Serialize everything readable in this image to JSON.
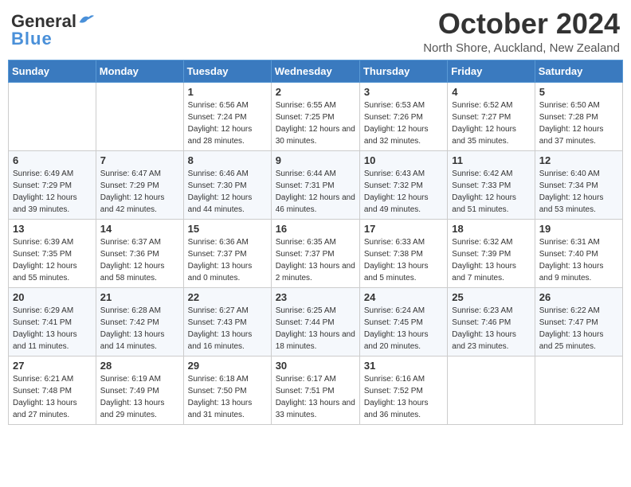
{
  "header": {
    "logo": {
      "general": "General",
      "blue": "Blue"
    },
    "title": "October 2024",
    "subtitle": "North Shore, Auckland, New Zealand"
  },
  "days_of_week": [
    "Sunday",
    "Monday",
    "Tuesday",
    "Wednesday",
    "Thursday",
    "Friday",
    "Saturday"
  ],
  "weeks": [
    [
      {
        "day": "",
        "info": ""
      },
      {
        "day": "",
        "info": ""
      },
      {
        "day": "1",
        "sunrise": "6:56 AM",
        "sunset": "7:24 PM",
        "daylight": "12 hours and 28 minutes."
      },
      {
        "day": "2",
        "sunrise": "6:55 AM",
        "sunset": "7:25 PM",
        "daylight": "12 hours and 30 minutes."
      },
      {
        "day": "3",
        "sunrise": "6:53 AM",
        "sunset": "7:26 PM",
        "daylight": "12 hours and 32 minutes."
      },
      {
        "day": "4",
        "sunrise": "6:52 AM",
        "sunset": "7:27 PM",
        "daylight": "12 hours and 35 minutes."
      },
      {
        "day": "5",
        "sunrise": "6:50 AM",
        "sunset": "7:28 PM",
        "daylight": "12 hours and 37 minutes."
      }
    ],
    [
      {
        "day": "6",
        "sunrise": "6:49 AM",
        "sunset": "7:29 PM",
        "daylight": "12 hours and 39 minutes."
      },
      {
        "day": "7",
        "sunrise": "6:47 AM",
        "sunset": "7:29 PM",
        "daylight": "12 hours and 42 minutes."
      },
      {
        "day": "8",
        "sunrise": "6:46 AM",
        "sunset": "7:30 PM",
        "daylight": "12 hours and 44 minutes."
      },
      {
        "day": "9",
        "sunrise": "6:44 AM",
        "sunset": "7:31 PM",
        "daylight": "12 hours and 46 minutes."
      },
      {
        "day": "10",
        "sunrise": "6:43 AM",
        "sunset": "7:32 PM",
        "daylight": "12 hours and 49 minutes."
      },
      {
        "day": "11",
        "sunrise": "6:42 AM",
        "sunset": "7:33 PM",
        "daylight": "12 hours and 51 minutes."
      },
      {
        "day": "12",
        "sunrise": "6:40 AM",
        "sunset": "7:34 PM",
        "daylight": "12 hours and 53 minutes."
      }
    ],
    [
      {
        "day": "13",
        "sunrise": "6:39 AM",
        "sunset": "7:35 PM",
        "daylight": "12 hours and 55 minutes."
      },
      {
        "day": "14",
        "sunrise": "6:37 AM",
        "sunset": "7:36 PM",
        "daylight": "12 hours and 58 minutes."
      },
      {
        "day": "15",
        "sunrise": "6:36 AM",
        "sunset": "7:37 PM",
        "daylight": "13 hours and 0 minutes."
      },
      {
        "day": "16",
        "sunrise": "6:35 AM",
        "sunset": "7:37 PM",
        "daylight": "13 hours and 2 minutes."
      },
      {
        "day": "17",
        "sunrise": "6:33 AM",
        "sunset": "7:38 PM",
        "daylight": "13 hours and 5 minutes."
      },
      {
        "day": "18",
        "sunrise": "6:32 AM",
        "sunset": "7:39 PM",
        "daylight": "13 hours and 7 minutes."
      },
      {
        "day": "19",
        "sunrise": "6:31 AM",
        "sunset": "7:40 PM",
        "daylight": "13 hours and 9 minutes."
      }
    ],
    [
      {
        "day": "20",
        "sunrise": "6:29 AM",
        "sunset": "7:41 PM",
        "daylight": "13 hours and 11 minutes."
      },
      {
        "day": "21",
        "sunrise": "6:28 AM",
        "sunset": "7:42 PM",
        "daylight": "13 hours and 14 minutes."
      },
      {
        "day": "22",
        "sunrise": "6:27 AM",
        "sunset": "7:43 PM",
        "daylight": "13 hours and 16 minutes."
      },
      {
        "day": "23",
        "sunrise": "6:25 AM",
        "sunset": "7:44 PM",
        "daylight": "13 hours and 18 minutes."
      },
      {
        "day": "24",
        "sunrise": "6:24 AM",
        "sunset": "7:45 PM",
        "daylight": "13 hours and 20 minutes."
      },
      {
        "day": "25",
        "sunrise": "6:23 AM",
        "sunset": "7:46 PM",
        "daylight": "13 hours and 23 minutes."
      },
      {
        "day": "26",
        "sunrise": "6:22 AM",
        "sunset": "7:47 PM",
        "daylight": "13 hours and 25 minutes."
      }
    ],
    [
      {
        "day": "27",
        "sunrise": "6:21 AM",
        "sunset": "7:48 PM",
        "daylight": "13 hours and 27 minutes."
      },
      {
        "day": "28",
        "sunrise": "6:19 AM",
        "sunset": "7:49 PM",
        "daylight": "13 hours and 29 minutes."
      },
      {
        "day": "29",
        "sunrise": "6:18 AM",
        "sunset": "7:50 PM",
        "daylight": "13 hours and 31 minutes."
      },
      {
        "day": "30",
        "sunrise": "6:17 AM",
        "sunset": "7:51 PM",
        "daylight": "13 hours and 33 minutes."
      },
      {
        "day": "31",
        "sunrise": "6:16 AM",
        "sunset": "7:52 PM",
        "daylight": "13 hours and 36 minutes."
      },
      {
        "day": "",
        "info": ""
      },
      {
        "day": "",
        "info": ""
      }
    ]
  ]
}
